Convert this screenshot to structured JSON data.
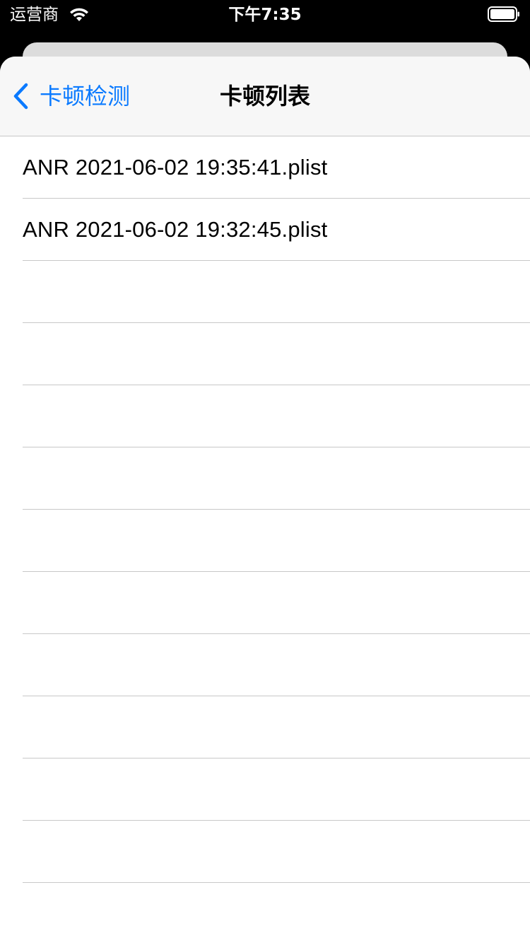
{
  "status_bar": {
    "carrier": "运营商",
    "time": "下午7:35",
    "wifi_icon": "wifi-icon",
    "battery_icon": "battery-icon"
  },
  "nav": {
    "back_label": "卡顿检测",
    "back_icon": "chevron-left-icon",
    "title": "卡顿列表",
    "accent_color": "#0a7aff"
  },
  "list": {
    "items": [
      {
        "label": "ANR 2021-06-02 19:35:41.plist"
      },
      {
        "label": "ANR 2021-06-02 19:32:45.plist"
      }
    ]
  }
}
